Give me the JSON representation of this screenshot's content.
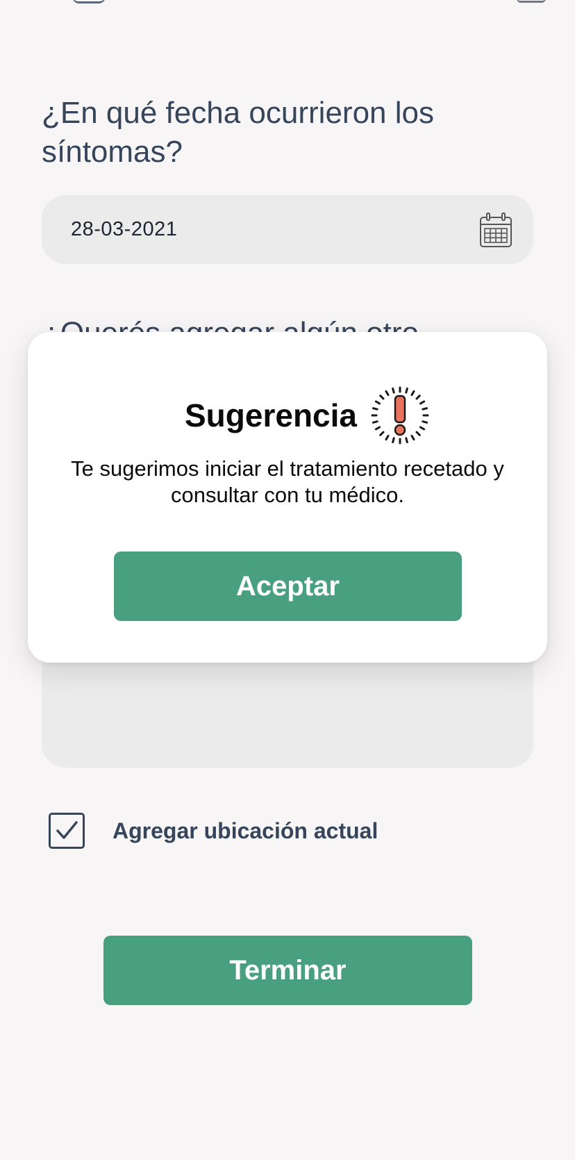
{
  "form": {
    "date_question": "¿En qué fecha ocurrieron los síntomas?",
    "date_value": "28-03-2021",
    "other_question": "¿Querés agregar algún otro",
    "location_checkbox_label": "Agregar ubicación actual",
    "location_checked": true,
    "finish_button": "Terminar"
  },
  "modal": {
    "title": "Sugerencia",
    "message": "Te sugerimos iniciar el tratamiento recetado y consultar con tu médico.",
    "accept_button": "Aceptar"
  },
  "icons": {
    "date_field": "calendar-icon",
    "modal_title": "alert-exclamation-icon",
    "checkbox": "checkmark-icon"
  },
  "colors": {
    "primary_green": "#48a081",
    "text_dark": "#36455a",
    "field_bg": "#ebebeb",
    "alert_red": "#e8735f"
  }
}
